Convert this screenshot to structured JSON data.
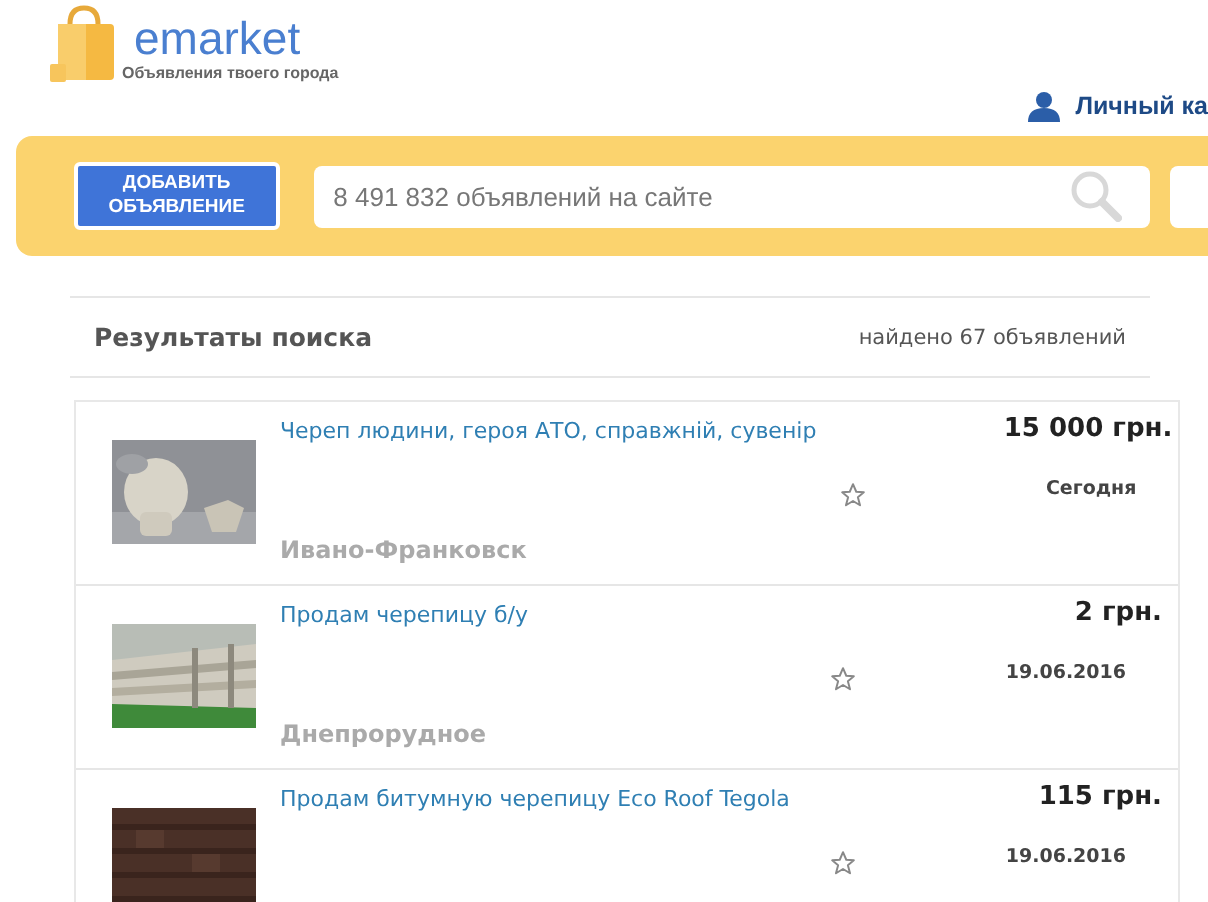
{
  "logo": {
    "name": "emarket",
    "tagline": "Объявления твоего города"
  },
  "account_link": "Личный ка",
  "search_bar": {
    "add_button": "ДОБАВИТЬ ОБЪЯВЛЕНИЕ",
    "placeholder": "8 491 832 объявлений на сайте"
  },
  "results": {
    "title": "Результаты поиска",
    "count": "найдено 67 объявлений"
  },
  "listings": [
    {
      "title": "Череп людини, героя АТО, справжній, сувенір",
      "location": "Ивано-Франковск",
      "price": "15 000 грн.",
      "date": "Сегодня",
      "kind": "picture"
    },
    {
      "title": "Продам черепицу б/у",
      "location": "Днепрорудное",
      "price": "2 грн.",
      "date": "19.06.2016",
      "kind": "picture"
    },
    {
      "title": "Продам битумную черепицу Eco Roof Tegola",
      "price": "115 грн.",
      "date": "19.06.2016",
      "kind": "picture"
    }
  ]
}
